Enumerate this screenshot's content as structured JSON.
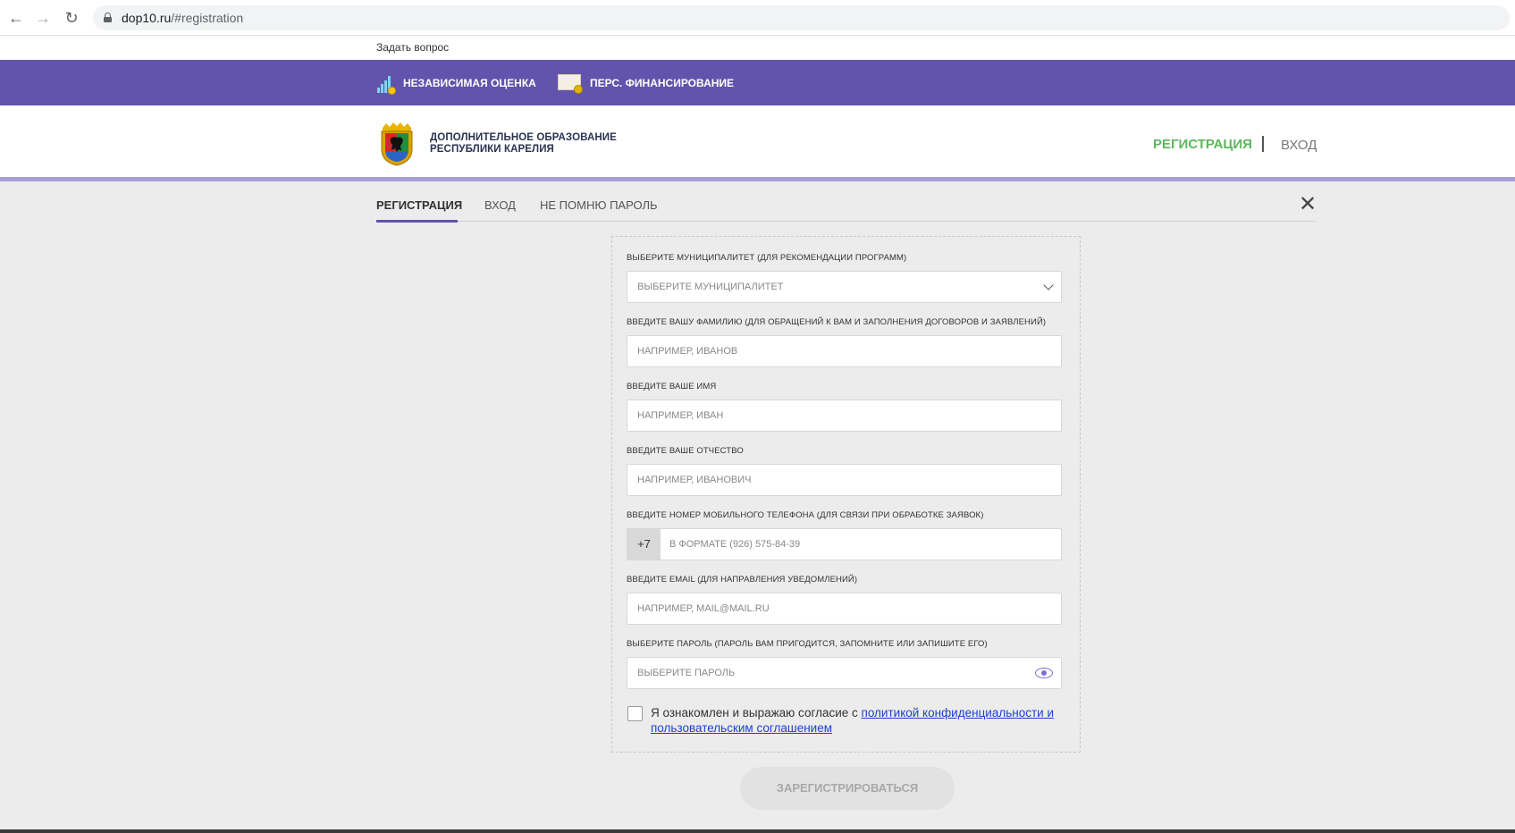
{
  "browser": {
    "url_host": "dop10.ru",
    "url_path": "/#registration",
    "back_icon": "←",
    "forward_icon": "→",
    "reload_icon": "↻"
  },
  "topbar": {
    "ask_question": "Задать вопрос"
  },
  "purple_nav": {
    "independent_assessment": "НЕЗАВИСИМАЯ ОЦЕНКА",
    "personal_funding": "ПЕРС. ФИНАНСИРОВАНИЕ"
  },
  "header": {
    "logo_line1": "ДОПОЛНИТЕЛЬНОЕ ОБРАЗОВАНИЕ",
    "logo_line2": "РЕСПУБЛИКИ КАРЕЛИЯ",
    "registration": "РЕГИСТРАЦИЯ",
    "login": "ВХОД"
  },
  "tabs": {
    "registration": "РЕГИСТРАЦИЯ",
    "login": "ВХОД",
    "forgot": "НЕ ПОМНЮ ПАРОЛЬ",
    "close": "✕"
  },
  "form": {
    "municipality_label": "ВЫБЕРИТЕ МУНИЦИПАЛИТЕТ (ДЛЯ РЕКОМЕНДАЦИИ ПРОГРАММ)",
    "municipality_placeholder": "ВЫБЕРИТЕ МУНИЦИПАЛИТЕТ",
    "surname_label": "ВВЕДИТЕ ВАШУ ФАМИЛИЮ (ДЛЯ ОБРАЩЕНИЙ К ВАМ И ЗАПОЛНЕНИЯ ДОГОВОРОВ И ЗАЯВЛЕНИЙ)",
    "surname_placeholder": "НАПРИМЕР, ИВАНОВ",
    "name_label": "ВВЕДИТЕ ВАШЕ ИМЯ",
    "name_placeholder": "НАПРИМЕР, ИВАН",
    "patronymic_label": "ВВЕДИТЕ ВАШЕ ОТЧЕСТВО",
    "patronymic_placeholder": "НАПРИМЕР, ИВАНОВИЧ",
    "phone_label": "ВВЕДИТЕ НОМЕР МОБИЛЬНОГО ТЕЛЕФОНА (ДЛЯ СВЯЗИ ПРИ ОБРАБОТКЕ ЗАЯВОК)",
    "phone_prefix": "+7",
    "phone_placeholder": "В ФОРМАТЕ (926) 575-84-39",
    "email_label": "ВВЕДИТЕ EMAIL (ДЛЯ НАПРАВЛЕНИЯ УВЕДОМЛЕНИЙ)",
    "email_placeholder": "НАПРИМЕР, MAIL@MAIL.RU",
    "password_label": "ВЫБЕРИТЕ ПАРОЛЬ (ПАРОЛЬ ВАМ ПРИГОДИТСЯ, ЗАПОМНИТЕ ИЛИ ЗАПИШИТЕ ЕГО)",
    "password_placeholder": "ВЫБЕРИТЕ ПАРОЛЬ",
    "consent_text": "Я ознакомлен и выражаю согласие с ",
    "consent_link": "политикой конфиденциальности и пользовательским соглашением",
    "submit": "ЗАРЕГИСТРИРОВАТЬСЯ"
  },
  "colors": {
    "purple": "#6254ac",
    "green": "#5cb85c",
    "link": "#1a3fd6"
  }
}
